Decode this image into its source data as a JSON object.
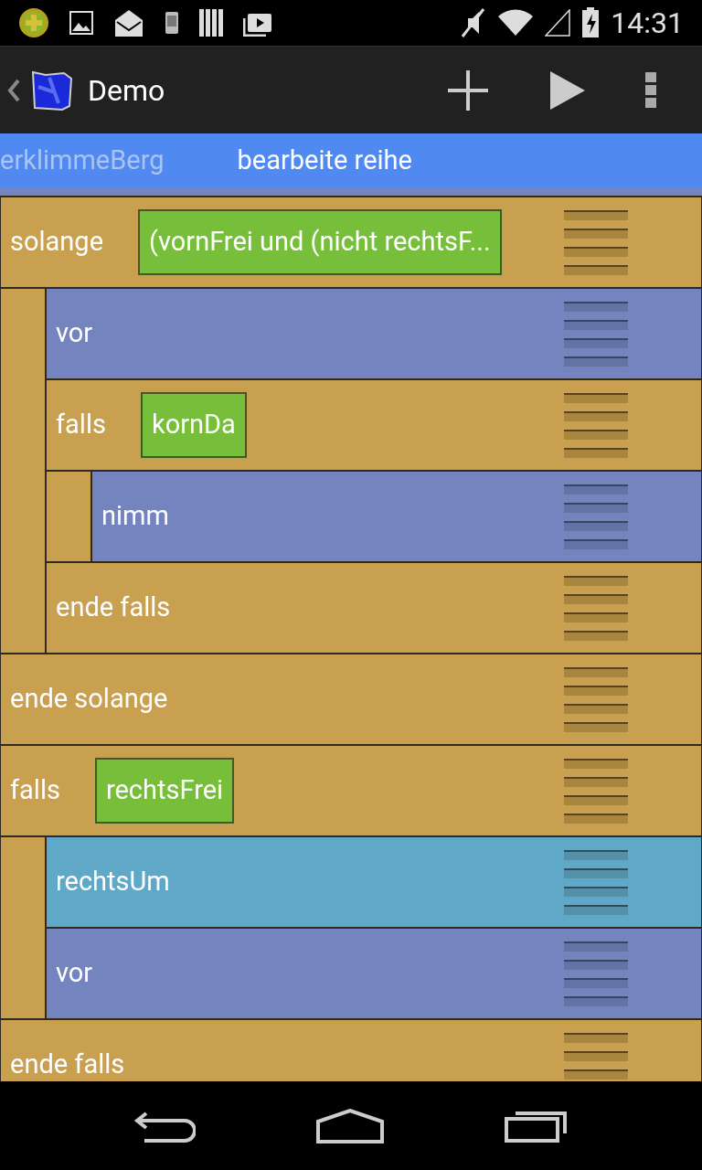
{
  "status_bar": {
    "time": "14:31"
  },
  "action_bar": {
    "title": "Demo"
  },
  "tabs": [
    {
      "label": "erklimmeBerg",
      "selected": false
    },
    {
      "label": "bearbeite reihe",
      "selected": true
    }
  ],
  "blocks": [
    {
      "kind": "control",
      "label": "solange",
      "condition": "(vornFrei und (nicht rechtsF...",
      "children": [
        {
          "kind": "command",
          "label": "vor"
        },
        {
          "kind": "control",
          "label": "falls",
          "condition": "kornDa",
          "children": [
            {
              "kind": "command",
              "label": "nimm"
            }
          ]
        },
        {
          "kind": "control",
          "label": "ende falls"
        }
      ]
    },
    {
      "kind": "control",
      "label": "ende solange"
    },
    {
      "kind": "control",
      "label": "falls",
      "condition": "rechtsFrei",
      "children": [
        {
          "kind": "call",
          "label": "rechtsUm"
        },
        {
          "kind": "command",
          "label": "vor"
        }
      ]
    },
    {
      "kind": "control",
      "label": "ende falls"
    }
  ]
}
